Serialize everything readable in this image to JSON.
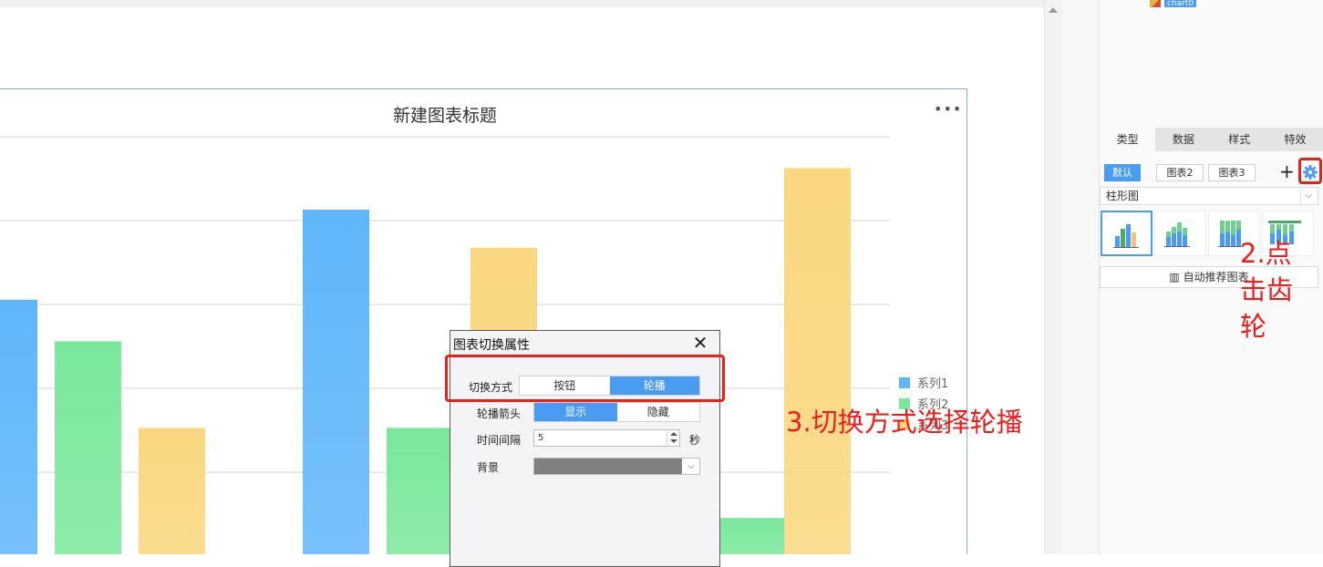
{
  "editor": {
    "top_item_label": "chart0"
  },
  "chart_data": {
    "type": "bar",
    "title": "新建图表标题",
    "categories": [
      "",
      ""
    ],
    "series": [
      {
        "name": "系列1",
        "color": "#5fb6fa",
        "values": [
          74,
          100
        ]
      },
      {
        "name": "系列2",
        "color": "#7ae89b",
        "values": [
          62,
          37
        ]
      },
      {
        "name": "系列3",
        "color": "#fad77e",
        "values": [
          37,
          89
        ]
      }
    ],
    "extra_bars": [
      {
        "series": "系列2",
        "value": 11
      },
      {
        "series": "系列3",
        "value": 112
      }
    ],
    "grid": true,
    "legend_position": "right"
  },
  "dialog": {
    "title": "图表切换属性",
    "rows": {
      "switch_mode": {
        "label": "切换方式",
        "options": [
          "按钮",
          "轮播"
        ],
        "selected": "轮播"
      },
      "carousel_arrow": {
        "label": "轮播箭头",
        "options": [
          "显示",
          "隐藏"
        ],
        "selected": "显示"
      },
      "interval": {
        "label": "时间间隔",
        "value": "5",
        "unit": "秒"
      },
      "background": {
        "label": "背景",
        "color": "#808080"
      }
    }
  },
  "panel": {
    "tabs": [
      {
        "label": "类型",
        "active": true
      },
      {
        "label": "数据",
        "active": false
      },
      {
        "label": "样式",
        "active": false
      },
      {
        "label": "特效",
        "active": false
      }
    ],
    "chart_chips": [
      {
        "label": "默认",
        "active": true
      },
      {
        "label": "图表2",
        "active": false
      },
      {
        "label": "图表3",
        "active": false
      }
    ],
    "add_icon": "plus-icon",
    "gear_icon": "gear-icon",
    "chart_type_select": "柱形图",
    "recommend_label": "自动推荐图表"
  },
  "annotations": {
    "step2": "2.点击齿轮",
    "step3": "3.切换方式选择轮播"
  },
  "colors": {
    "accent": "#4a9cf2",
    "annotation": "#ee1c1c"
  }
}
